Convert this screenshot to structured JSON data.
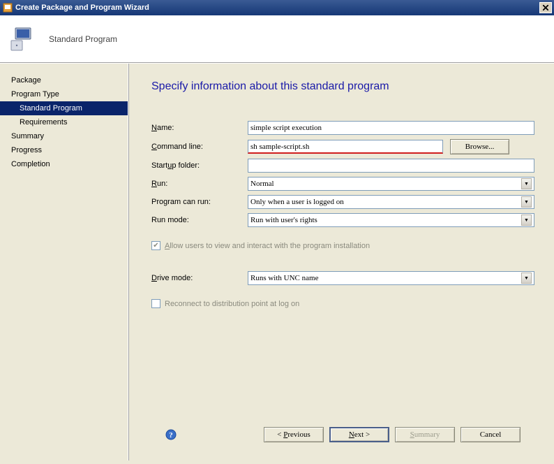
{
  "window": {
    "title": "Create Package and Program Wizard"
  },
  "header": {
    "title": "Standard Program"
  },
  "sidebar": {
    "items": [
      {
        "label": "Package",
        "indent": false,
        "selected": false
      },
      {
        "label": "Program Type",
        "indent": false,
        "selected": false
      },
      {
        "label": "Standard Program",
        "indent": true,
        "selected": true
      },
      {
        "label": "Requirements",
        "indent": true,
        "selected": false
      },
      {
        "label": "Summary",
        "indent": false,
        "selected": false
      },
      {
        "label": "Progress",
        "indent": false,
        "selected": false
      },
      {
        "label": "Completion",
        "indent": false,
        "selected": false
      }
    ]
  },
  "content": {
    "title": "Specify information about this standard program",
    "labels": {
      "name": "Name:",
      "command_line": "Command line:",
      "startup_folder": "Startup folder:",
      "run": "Run:",
      "program_can_run": "Program can run:",
      "run_mode": "Run mode:",
      "drive_mode": "Drive mode:"
    },
    "labels_accesskey": {
      "name_u": "N",
      "name_r": "ame:",
      "cmd_u": "C",
      "cmd_r": "ommand line:",
      "startup_pre": "Start",
      "startup_u": "u",
      "startup_r": "p folder:",
      "run_u": "R",
      "run_r": "un:",
      "drive_u": "D",
      "drive_r": "rive mode:"
    },
    "values": {
      "name": "simple script execution",
      "command_line": "sh sample-script.sh",
      "startup_folder": "",
      "run": "Normal",
      "program_can_run": "Only when a user is logged on",
      "run_mode": "Run with user's rights",
      "drive_mode": "Runs with UNC name"
    },
    "buttons": {
      "browse": "Browse..."
    },
    "checkboxes": {
      "allow_interact": {
        "label_pre": "",
        "label_u": "A",
        "label_r": "llow users to view and interact with the program installation",
        "checked": true,
        "disabled": true
      },
      "reconnect": {
        "label": "Reconnect to distribution point at log on",
        "checked": false,
        "disabled": true
      }
    }
  },
  "footer": {
    "previous": "< Previous",
    "next": "Next >",
    "summary": "Summary",
    "cancel": "Cancel"
  }
}
